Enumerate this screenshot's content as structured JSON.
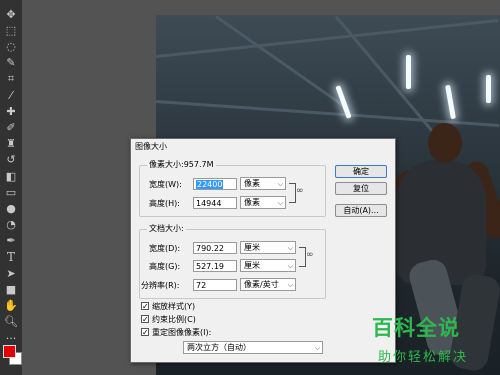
{
  "toolbar": {
    "tools": [
      {
        "name": "move-icon",
        "glyph": "✥"
      },
      {
        "name": "marquee-icon",
        "glyph": "⬚"
      },
      {
        "name": "lasso-icon",
        "glyph": "◌"
      },
      {
        "name": "quick-select-icon",
        "glyph": "✎"
      },
      {
        "name": "crop-icon",
        "glyph": "⌗"
      },
      {
        "name": "eyedropper-icon",
        "glyph": "⁄"
      },
      {
        "name": "healing-brush-icon",
        "glyph": "✚"
      },
      {
        "name": "brush-icon",
        "glyph": "✐"
      },
      {
        "name": "clone-stamp-icon",
        "glyph": "♜"
      },
      {
        "name": "history-brush-icon",
        "glyph": "↺"
      },
      {
        "name": "eraser-icon",
        "glyph": "◧"
      },
      {
        "name": "gradient-icon",
        "glyph": "▭"
      },
      {
        "name": "blur-icon",
        "glyph": "●"
      },
      {
        "name": "dodge-icon",
        "glyph": "◔"
      },
      {
        "name": "pen-icon",
        "glyph": "✒"
      },
      {
        "name": "type-icon",
        "glyph": "T"
      },
      {
        "name": "path-select-icon",
        "glyph": "➤"
      },
      {
        "name": "shape-icon",
        "glyph": "■"
      },
      {
        "name": "hand-icon",
        "glyph": "✋"
      },
      {
        "name": "zoom-icon",
        "glyph": "🔍︎"
      },
      {
        "name": "more-icon",
        "glyph": "···"
      }
    ],
    "foreground_color": "#e00000",
    "background_color": "#ffffff"
  },
  "dialog": {
    "title": "图像大小",
    "pixel_group": {
      "legend": "像素大小:957.7M",
      "width_label": "宽度(W):",
      "width_value": "22400",
      "width_unit": "像素",
      "height_label": "高度(H):",
      "height_value": "14944",
      "height_unit": "像素"
    },
    "doc_group": {
      "legend": "文档大小:",
      "width_label": "宽度(D):",
      "width_value": "790.22",
      "width_unit": "厘米",
      "height_label": "高度(G):",
      "height_value": "527.19",
      "height_unit": "厘米",
      "res_label": "分辨率(R):",
      "res_value": "72",
      "res_unit": "像素/英寸"
    },
    "checkboxes": [
      {
        "label": "缩放样式(Y)",
        "checked": true
      },
      {
        "label": "约束比例(C)",
        "checked": true
      },
      {
        "label": "重定图像像素(I):",
        "checked": true
      }
    ],
    "resample_method": "两次立方（自动）",
    "buttons": {
      "ok": "确定",
      "reset": "复位",
      "auto": "自动(A)..."
    }
  },
  "watermark": {
    "line1": "百科全说",
    "line2": "助你轻松解决"
  }
}
